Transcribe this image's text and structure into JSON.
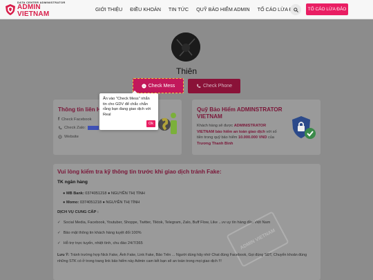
{
  "header": {
    "logo_top": "DATA CENTER ADMINISTRATOR",
    "logo_main": "ADMIN VIETNAM",
    "nav": [
      "GIỚI THIỆU",
      "ĐIỀU KHOẢN",
      "TIN TỨC",
      "QUỸ BẢO HIỂM ADMIN",
      "TỐ CÁO LỪA ĐẢO"
    ],
    "report_button": "TỐ CÁO LỪA ĐẢO"
  },
  "profile": {
    "name": "Thiên",
    "check_mess_label": "Check Mess",
    "check_phone_label": "Check Phone"
  },
  "tooltip": {
    "text": "Ấn vào \"Check Mess\" nhắn tin cho GDV để chắc chắn rằng bạn đang giao dịch với Real",
    "ok_label": "Ok"
  },
  "info_card": {
    "title": "Thông tin liên Hệ",
    "facebook": "Check Facebook",
    "zalo": "Check Zalo:",
    "website": "Website"
  },
  "insurance_card": {
    "title": "Quỹ Bảo Hiểm ADMINSTRATOR VIETNAM",
    "text_1": "Khách hàng sẽ được ",
    "text_bold_1": "ADMINISTRATOR VIETNAM bảo hiểm an toàn giao dịch",
    "text_2": " với số tiền trong quỹ bảo hiểm ",
    "amount": "10.000.000 VND",
    "text_3": " của ",
    "person": "Trương Thanh Bình"
  },
  "warning": {
    "title": "Vui lòng kiểm tra kỹ thông tin trước khi giao dịch tránh Fake:",
    "bank_heading": "TK ngân hàng",
    "banks": [
      {
        "bank": "MB Bank:",
        "detail": " 0374051218 ● NGUYỄN THỊ TÌNH"
      },
      {
        "bank": "Momo:",
        "detail": " 0374051218 ● NGUYỄN THỊ TÌNH"
      }
    ],
    "services_heading": "DỊCH VỤ CUNG CẤP :",
    "services": [
      "Social Media, Facebook, Youtuber, Shoppe, Twitter, Tiktok, Telegram, Zalo, Buff Flow, Like ...vv uy tín hàng đầu Việt Nam",
      "Bảo mật thông tin khách hàng tuyệt đối 100%",
      "Hỗ trợ trực tuyến, nhiệt tình, chu đáo 24/7/365"
    ],
    "note_label": "Lưu Ý:",
    "note_text": " Tránh trường hợp Nick Fake, Ảnh Fake, Link Fake, Bảo Trên ... Người dùng hãy nhớ Chat đúng Facebook, Gọi đúng SĐT, Chuyển khoản đúng những STK có ở trong trang link bảo hiểm này Admin cam kết bạn sẽ an toàn trong mọi giao dịch !!!"
  },
  "watermark": "ADMIN VIETNAM",
  "colors": {
    "accent": "#e91e63",
    "brand": "#d81e4a",
    "title": "#7a1638"
  }
}
